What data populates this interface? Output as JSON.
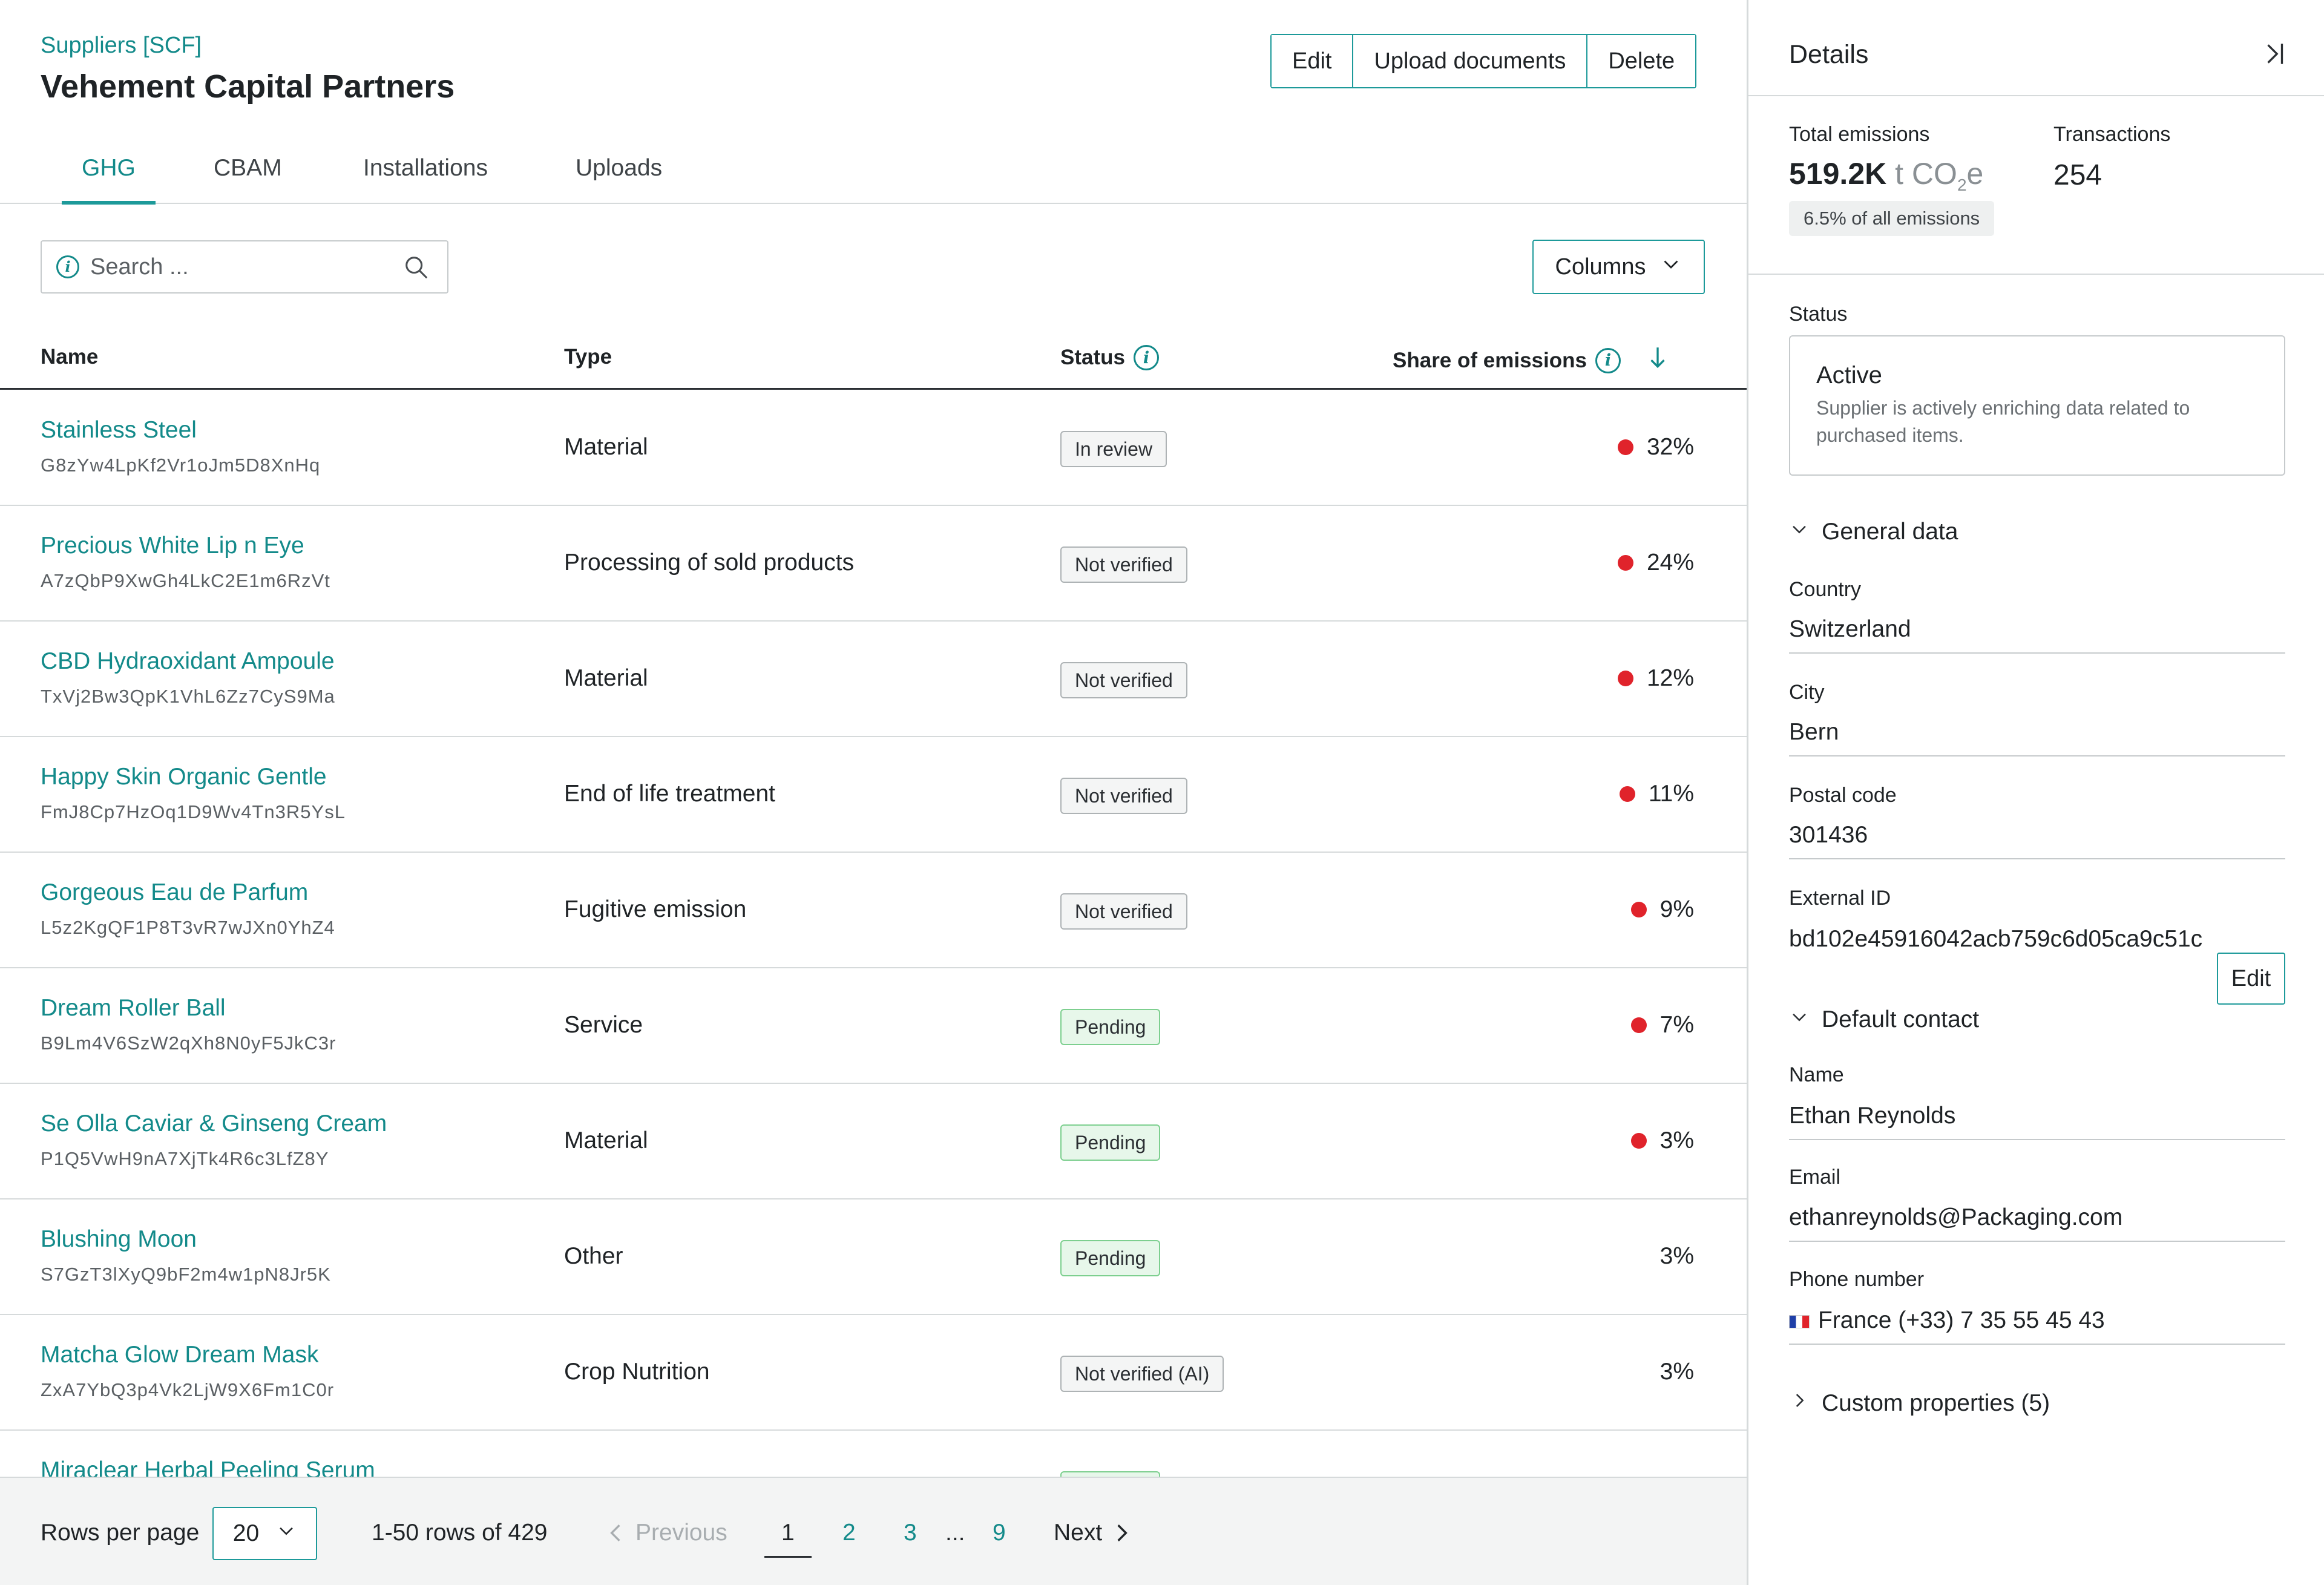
{
  "header": {
    "breadcrumb": "Suppliers [SCF]",
    "title": "Vehement Capital Partners",
    "actions": {
      "edit": "Edit",
      "upload": "Upload documents",
      "delete": "Delete"
    }
  },
  "tabs": [
    {
      "label": "GHG",
      "active": true
    },
    {
      "label": "CBAM"
    },
    {
      "label": "Installations"
    },
    {
      "label": "Uploads"
    }
  ],
  "search": {
    "placeholder": "Search ..."
  },
  "columns_button": {
    "label": "Columns"
  },
  "table": {
    "headers": {
      "name": "Name",
      "type": "Type",
      "status": "Status",
      "share": "Share of emissions"
    },
    "rows": [
      {
        "name": "Stainless Steel",
        "code": "G8zYw4LpKf2Vr1oJm5D8XnHq",
        "type": "Material",
        "status": "In review",
        "share": "32%",
        "dot": true
      },
      {
        "name": "Precious White Lip n Eye",
        "code": "A7zQbP9XwGh4LkC2E1m6RzVt",
        "type": "Processing of sold products",
        "status": "Not verified",
        "share": "24%",
        "dot": true
      },
      {
        "name": "CBD Hydraoxidant Ampoule",
        "code": "TxVj2Bw3QpK1VhL6Zz7CyS9Ma",
        "type": "Material",
        "status": "Not verified",
        "share": "12%",
        "dot": true
      },
      {
        "name": "Happy Skin Organic Gentle",
        "code": "FmJ8Cp7HzOq1D9Wv4Tn3R5YsL",
        "type": "End of life treatment",
        "status": "Not verified",
        "share": "11%",
        "dot": true
      },
      {
        "name": "Gorgeous Eau de Parfum",
        "code": "L5z2KgQF1P8T3vR7wJXn0YhZ4",
        "type": "Fugitive emission",
        "status": "Not verified",
        "share": "9%",
        "dot": true
      },
      {
        "name": "Dream Roller Ball",
        "code": "B9Lm4V6SzW2qXh8N0yF5JkC3r",
        "type": "Service",
        "status": "Pending",
        "share": "7%",
        "dot": true
      },
      {
        "name": "Se Olla Caviar & Ginseng Cream",
        "code": "P1Q5VwH9nA7XjTk4R6c3LfZ8Y",
        "type": "Material",
        "status": "Pending",
        "share": "3%",
        "dot": true
      },
      {
        "name": "Blushing Moon",
        "code": "S7GzT3lXyQ9bF2m4w1pN8Jr5K",
        "type": "Other",
        "status": "Pending",
        "share": "3%",
        "dot": false
      },
      {
        "name": "Matcha Glow Dream Mask",
        "code": "ZxA7YbQ3p4Vk2LjW9X6Fm1C0r",
        "type": "Crop Nutrition",
        "status": "Not verified (AI)",
        "share": "3%",
        "dot": false
      },
      {
        "name": "Miraclear Herbal Peeling Serum",
        "code": "",
        "type": "",
        "status": "Pending",
        "share": "",
        "dot": false
      }
    ]
  },
  "pagination": {
    "rows_per_page_label": "Rows per page",
    "rows_per_page": "20",
    "range": "1-50 rows of 429",
    "previous": "Previous",
    "pages": [
      "1",
      "2",
      "3",
      "...",
      "9"
    ],
    "current": "1",
    "next": "Next"
  },
  "details": {
    "title": "Details",
    "total_emissions_label": "Total emissions",
    "total_emissions_value": "519.2K",
    "total_emissions_unit": "t CO",
    "total_emissions_unit_sub": "2",
    "total_emissions_unit_tail": "e",
    "transactions_label": "Transactions",
    "transactions_value": "254",
    "share_badge": "6.5% of all emissions",
    "status_label": "Status",
    "status_value": "Active",
    "status_desc": "Supplier is actively enriching data related to purchased items.",
    "general_data_label": "General data",
    "fields": {
      "country_label": "Country",
      "country": "Switzerland",
      "city_label": "City",
      "city": "Bern",
      "postal_label": "Postal code",
      "postal": "301436",
      "external_id_label": "External ID",
      "external_id": "bd102e45916042acb759c6d05ca9c51c"
    },
    "default_contact_label": "Default contact",
    "contact_edit": "Edit",
    "contact": {
      "name_label": "Name",
      "name": "Ethan Reynolds",
      "email_label": "Email",
      "email": "ethanreynolds@Packaging.com",
      "phone_label": "Phone number",
      "phone": "France (+33) 7 35 55 45 43"
    },
    "custom_properties": "Custom properties (5)"
  },
  "colors": {
    "accent": "#138a8a",
    "danger_dot": "#e0232b",
    "pending_bg": "#e7f7ea"
  }
}
